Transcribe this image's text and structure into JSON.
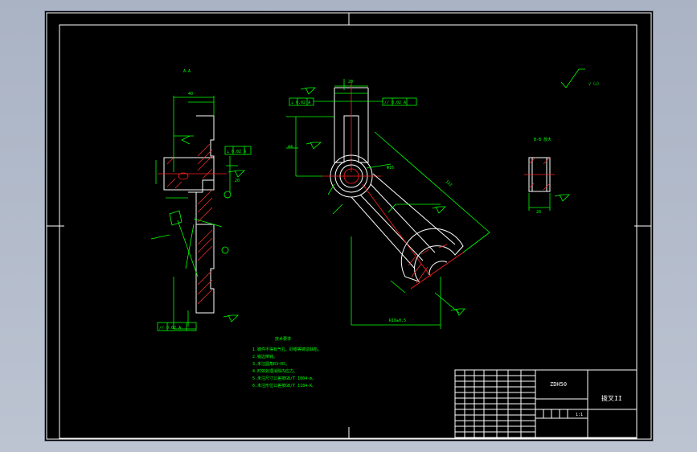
{
  "colors": {
    "background": "#000000",
    "outline": "#ffffff",
    "dimension": "#00ff00",
    "centerline": "#ff2020",
    "desktop": "#aab3c4"
  },
  "drawing": {
    "roughness_symbol": "√（√）",
    "left_view_label": "A-A",
    "section_label": "B-B 放大",
    "dimension_labels": {
      "flange_width": "40",
      "gap_top": "20",
      "boss_len": "44",
      "boss_dia": "Φ16",
      "arm_len": "122",
      "center_dim": "R18±0.5",
      "section_w": "20"
    },
    "tolerance_frames": {
      "left_perp": "⊥ 0.02 A",
      "left_parallel": "// 0.02 A",
      "main_perp": "⊥ 0.02 A",
      "main_parallel": "// 0.02 A"
    }
  },
  "tech_requirements": {
    "title": "技术要求",
    "items": [
      "1.铸件不得有气孔、砂眼等铸造缺陷。",
      "2.锐边倒钝。",
      "3.未注圆角R3~R5。",
      "4.时效处理消除内应力。",
      "5.未注尺寸公差按GB/T 1804-m。",
      "6.未注形位公差按GB/T 1184-K。"
    ]
  },
  "title_block": {
    "part_code": "ZDH50",
    "part_name": "拨叉II",
    "scale": "1:1"
  }
}
